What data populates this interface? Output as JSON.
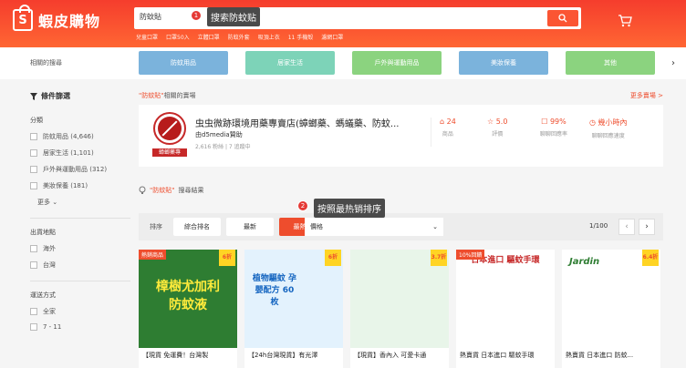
{
  "header": {
    "logo_text": "蝦皮購物",
    "logo_mark": "S",
    "search_value": "防蚊貼",
    "hotwords": [
      "兒童口罩",
      "口罩50入",
      "立體口罩",
      "防蚊外套",
      "吸頂上衣",
      "11 手機殼",
      "濾網口罩"
    ]
  },
  "annotations": {
    "step1_num": "1",
    "step1_text": "搜索防蚊贴",
    "step2_num": "2",
    "step2_text": "按照最热销排序"
  },
  "categories": {
    "label": "相關的搜尋",
    "items": [
      {
        "label": "防蚊用品",
        "color": "#7bb3dc"
      },
      {
        "label": "居家生活",
        "color": "#7dd3b8"
      },
      {
        "label": "戶外與運動用品",
        "color": "#8bd37f"
      },
      {
        "label": "美妝保養",
        "color": "#7bb3dc"
      },
      {
        "label": "其他",
        "color": "#8bd37f"
      }
    ]
  },
  "sidebar": {
    "title": "條件篩選",
    "group1_title": "分類",
    "group1_options": [
      "防蚊用品 (4,646)",
      "居家生活 (1,101)",
      "戶外與運動用品 (312)",
      "美妝保養 (181)"
    ],
    "more": "更多",
    "group2_title": "出貨地點",
    "group2_options": [
      "海外",
      "台灣"
    ],
    "group3_title": "運送方式",
    "group3_options": [
      "全家",
      "7 - 11"
    ]
  },
  "shop": {
    "heading_prefix": "\"防蚊貼\"",
    "heading_suffix": "相關的賣場",
    "more": "更多賣場 >",
    "name": "虫虫微跡環境用藥專賣店(蟑螂藥、螞蟻藥、防蚊...",
    "sub": "由d5media贊助",
    "stats_line": "2,616 粉絲 | 7 追蹤中",
    "tag": "蟑螂藥專",
    "stat1_value": "24",
    "stat1_label": "商品",
    "stat2_value": "5.0",
    "stat2_label": "評價",
    "stat3_value": "99%",
    "stat3_label": "聊聊回應率",
    "stat4_value": "幾小時內",
    "stat4_label": "聊聊回應速度"
  },
  "results": {
    "prefix": "\"防蚊貼\"",
    "suffix": "搜尋結果"
  },
  "sort": {
    "label": "排序",
    "relevance": "綜合排名",
    "latest": "最新",
    "top_sales": "最熱銷",
    "price": "價格",
    "pager": "1/100"
  },
  "products": [
    {
      "title": "【現貨 免運費！台灣製",
      "discount": "6折",
      "corner": "熱銷商品",
      "bg": "#2e7d32",
      "img_text": "樟樹尤加利 防蚊液"
    },
    {
      "title": "【24h台灣現貨】有光澤",
      "discount": "6折",
      "corner": "",
      "bg": "#e3f2fd",
      "img_text": "植物驅蚊 孕嬰配方 60枚"
    },
    {
      "title": "【現貨】香內入 可愛卡通",
      "discount": "3.7折",
      "corner": "",
      "bg": "#e8f5e9",
      "img_text": ""
    },
    {
      "title": "熱賣貨 日本進口 驅蚊手環",
      "discount": "",
      "corner": "10%回饋",
      "bg": "#ffffff",
      "img_text": "日本進口 驅蚊手環"
    },
    {
      "title": "熱賣貨 日本進口 防蚊...",
      "discount": "6.4折",
      "corner": "",
      "bg": "#ffffff",
      "img_text": "Jardin"
    }
  ]
}
